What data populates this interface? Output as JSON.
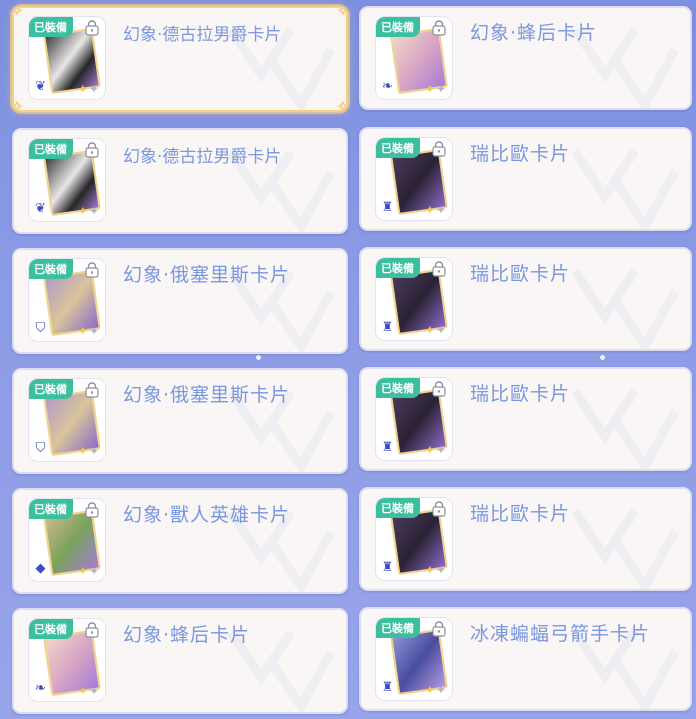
{
  "equipped_label": "已裝備",
  "left_column": [
    {
      "name": "幻象·德古拉男爵卡片",
      "art": "mono",
      "class_icon": "bat-icon",
      "selected": true
    },
    {
      "name": "幻象·德古拉男爵卡片",
      "art": "mono",
      "class_icon": "bat-icon",
      "selected": false
    },
    {
      "name": "幻象·俄塞里斯卡片",
      "art": "sepia",
      "class_icon": "shield-icon",
      "selected": false
    },
    {
      "name": "幻象·俄塞里斯卡片",
      "art": "sepia",
      "class_icon": "shield-icon",
      "selected": false
    },
    {
      "name": "幻象·獸人英雄卡片",
      "art": "green",
      "class_icon": "gem-icon",
      "selected": false
    },
    {
      "name": "幻象·蜂后卡片",
      "art": "pink",
      "class_icon": "wing-icon",
      "selected": false
    }
  ],
  "right_column": [
    {
      "name": "幻象·蜂后卡片",
      "art": "pink",
      "class_icon": "wing-icon",
      "selected": false
    },
    {
      "name": "瑞比歐卡片",
      "art": "dark",
      "class_icon": "flask-icon",
      "selected": false
    },
    {
      "name": "瑞比歐卡片",
      "art": "dark",
      "class_icon": "flask-icon",
      "selected": false
    },
    {
      "name": "瑞比歐卡片",
      "art": "dark",
      "class_icon": "flask-icon",
      "selected": false
    },
    {
      "name": "瑞比歐卡片",
      "art": "dark",
      "class_icon": "flask-icon",
      "selected": false
    },
    {
      "name": "冰凍蝙蝠弓箭手卡片",
      "art": "blue",
      "class_icon": "flask-icon",
      "selected": false
    }
  ]
}
